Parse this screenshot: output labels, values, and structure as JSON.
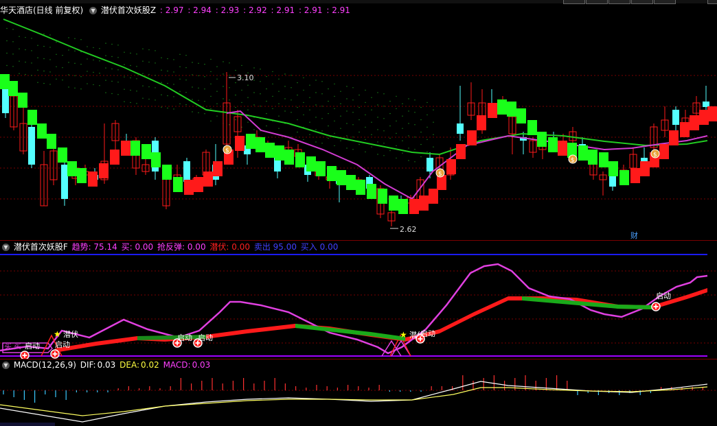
{
  "main_panel": {
    "stock_name": "华天酒店(日线 前复权)",
    "indicator_name": "潜伏首次妖股Z",
    "values": [
      ": 2.97",
      ": 2.94",
      ": 2.93",
      ": 2.92",
      ": 2.91",
      ": 2.91",
      ": 2.91"
    ],
    "high_label": "3.10",
    "low_label": "2.62",
    "marker_label": "财"
  },
  "indicator_panel": {
    "name": "潜伏首次妖股F",
    "fields": [
      {
        "label": "趋势:",
        "value": "75.14",
        "color": "#ff40ff"
      },
      {
        "label": "买:",
        "value": "0.00",
        "color": "#ff40ff"
      },
      {
        "label": "抢反弹:",
        "value": "0.00",
        "color": "#ff40ff"
      },
      {
        "label": "潜伏:",
        "value": "0.00",
        "color": "#ff2020"
      },
      {
        "label": "卖出",
        "value": "95.00",
        "color": "#4040ff"
      },
      {
        "label": "买入",
        "value": "0.00",
        "color": "#4040ff"
      }
    ],
    "signals": {
      "buy": "买",
      "start": "启动",
      "lurk": "潜伏"
    }
  },
  "macd_panel": {
    "name": "MACD(12,26,9)",
    "dif_label": "DIF:",
    "dif_value": "0.03",
    "dea_label": "DEA:",
    "dea_value": "0.02",
    "macd_label": "MACD:",
    "macd_value": "0.03"
  },
  "colors": {
    "up": "#ff1a1a",
    "down": "#54ffff",
    "green_bar": "#1aff1a",
    "ma_green": "#22cc22",
    "ma_magenta": "#d23cd2",
    "grid": "#7a0000"
  }
}
